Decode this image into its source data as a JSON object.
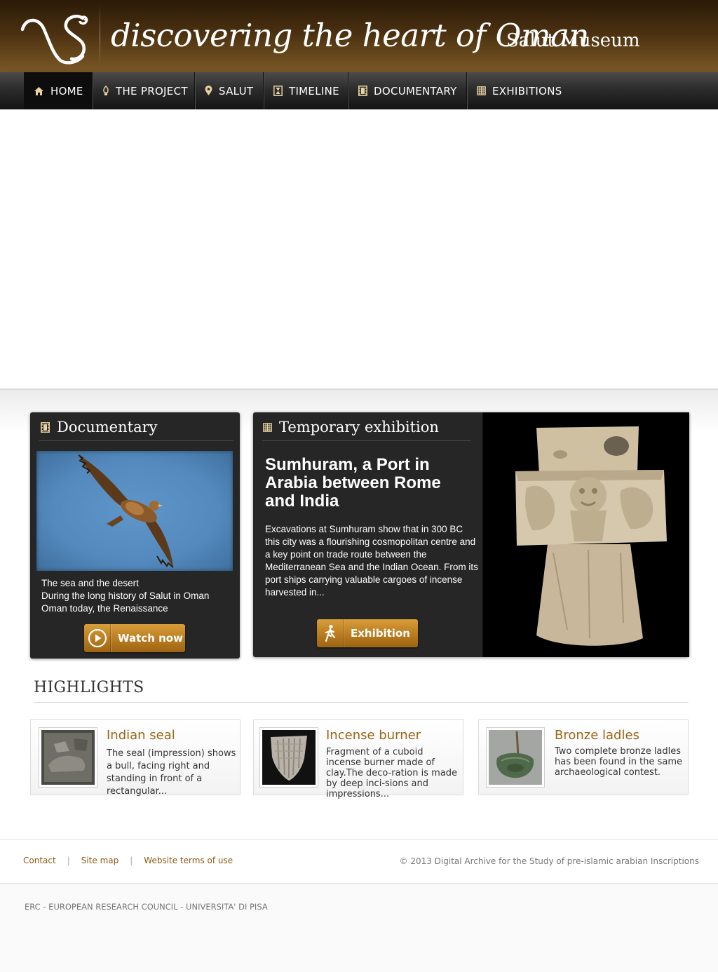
{
  "header": {
    "title": "discovering the heart of Oman",
    "subtitle": "Salut Museum"
  },
  "nav": {
    "items": [
      {
        "label": "HOME",
        "icon": "home-icon",
        "active": true
      },
      {
        "label": "THE PROJECT",
        "icon": "pen-nib-icon"
      },
      {
        "label": "SALUT",
        "icon": "map-pin-icon"
      },
      {
        "label": "TIMELINE",
        "icon": "hourglass-icon"
      },
      {
        "label": "DOCUMENTARY",
        "icon": "film-icon"
      },
      {
        "label": "EXHIBITIONS",
        "icon": "calendar-icon"
      }
    ]
  },
  "documentary": {
    "heading": "Documentary",
    "episodes": [
      "The sea and the desert",
      "During the long history of Salut in Oman",
      "Oman today, the Renaissance"
    ],
    "button_label": "Watch now"
  },
  "exhibition": {
    "heading": "Temporary exhibition",
    "title": "Sumhuram, a Port in Arabia between Rome and India",
    "text": "Excavations at Sumhuram show that in 300 BC this city was a flourishing cosmopolitan centre and a key point on trade route between the Mediterranean Sea and the Indian Ocean. From its port ships carrying valuable cargoes of incense harvested in...",
    "button_label": "Exhibition"
  },
  "highlights": {
    "heading": "HIGHLIGHTS",
    "items": [
      {
        "name": "Indian seal",
        "description": "The seal (impression) shows a bull, facing right and standing in front of a rectangular..."
      },
      {
        "name": "Incense burner",
        "description": "Fragment of a cuboid incense burner made of clay.The deco-ration is made by deep inci-sions and impressions..."
      },
      {
        "name": "Bronze ladles",
        "description": "Two complete bronze ladles has been found in the same archaeological contest."
      }
    ]
  },
  "footer": {
    "links": [
      "Contact",
      "Site map",
      "Website terms of use"
    ],
    "separator": "|",
    "copyright": "© 2013 Digital Archive for the Study of pre-islamic arabian Inscriptions",
    "sponsors": "ERC - EUROPEAN RESEARCH COUNCIL  - UNIVERSITA' DI PISA"
  },
  "colors": {
    "header_brown": "#4a3010",
    "nav_dark": "#141414",
    "card_bg": "#262626",
    "accent_gold": "#b97c1f",
    "highlight_title": "#9a6616",
    "footer_link": "#8b5a12"
  }
}
